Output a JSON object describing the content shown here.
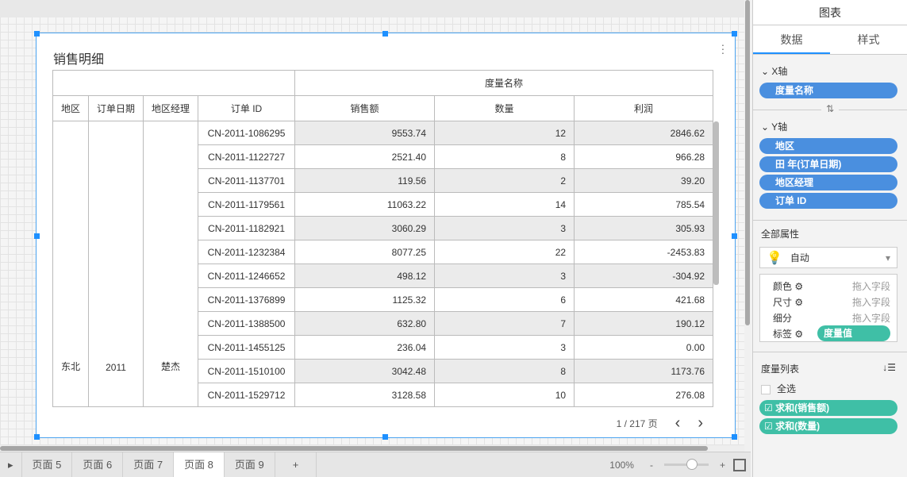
{
  "card": {
    "title": "销售明细"
  },
  "table": {
    "group_header": "度量名称",
    "columns": [
      "地区",
      "订单日期",
      "地区经理",
      "订单 ID",
      "销售额",
      "数量",
      "利润"
    ],
    "region": "东北",
    "year": "2011",
    "manager": "楚杰",
    "rows": [
      [
        "CN-2011-1086295",
        "9553.74",
        "12",
        "2846.62"
      ],
      [
        "CN-2011-1122727",
        "2521.40",
        "8",
        "966.28"
      ],
      [
        "CN-2011-1137701",
        "119.56",
        "2",
        "39.20"
      ],
      [
        "CN-2011-1179561",
        "11063.22",
        "14",
        "785.54"
      ],
      [
        "CN-2011-1182921",
        "3060.29",
        "3",
        "305.93"
      ],
      [
        "CN-2011-1232384",
        "8077.25",
        "22",
        "-2453.83"
      ],
      [
        "CN-2011-1246652",
        "498.12",
        "3",
        "-304.92"
      ],
      [
        "CN-2011-1376899",
        "1125.32",
        "6",
        "421.68"
      ],
      [
        "CN-2011-1388500",
        "632.80",
        "7",
        "190.12"
      ],
      [
        "CN-2011-1455125",
        "236.04",
        "3",
        "0.00"
      ],
      [
        "CN-2011-1510100",
        "3042.48",
        "8",
        "1173.76"
      ],
      [
        "CN-2011-1529712",
        "3128.58",
        "10",
        "276.08"
      ]
    ]
  },
  "pager": {
    "text": "1 / 217 页",
    "prev": "‹",
    "next": "›"
  },
  "tabs": [
    "页面 5",
    "页面 6",
    "页面 7",
    "页面 8",
    "页面 9",
    "+"
  ],
  "zoom": {
    "level": "100%",
    "minus": "-",
    "plus": "+"
  },
  "panel": {
    "title": "图表",
    "tabs": [
      "数据",
      "样式"
    ],
    "x_axis": {
      "label": "X轴",
      "fields": [
        "度量名称"
      ]
    },
    "swap": "⇅",
    "y_axis": {
      "label": "Y轴",
      "fields": [
        "地区",
        "田 年(订单日期)",
        "地区经理",
        "订单 ID"
      ]
    },
    "all_attrs": "全部属性",
    "auto": "自动",
    "props": [
      {
        "label": "颜色",
        "value": "拖入字段"
      },
      {
        "label": "尺寸",
        "value": "拖入字段"
      },
      {
        "label": "细分",
        "value": "拖入字段"
      },
      {
        "label": "标签",
        "value": "度量值"
      }
    ],
    "measure_list": "度量列表",
    "select_all": "全选",
    "measures": [
      "求和(销售额)",
      "求和(数量)"
    ]
  },
  "colors": {
    "accent": "#1e90ff",
    "pill_blue": "#4a8fdf",
    "pill_teal": "#3fbfa6"
  }
}
